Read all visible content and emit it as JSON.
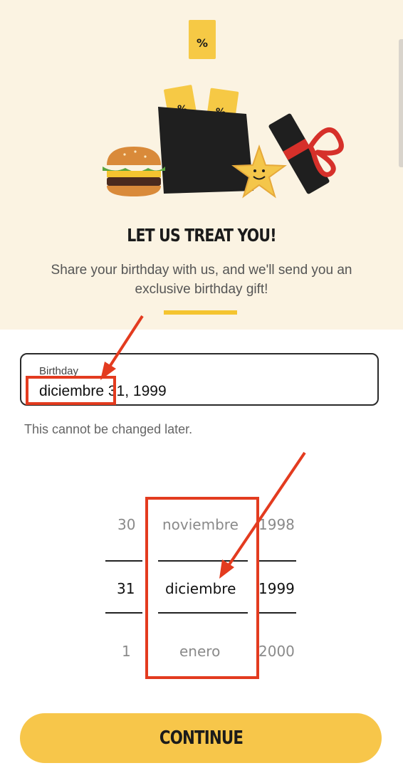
{
  "hero": {
    "title": "LET US TREAT YOU!",
    "description": "Share your birthday with us, and we'll send you an exclusive birthday gift!",
    "coupon_symbol": "%",
    "accent_color": "#f4c430",
    "background_color": "#fbf3e2"
  },
  "birthday_field": {
    "label": "Birthday",
    "value_month": "diciembre",
    "value_rest": " 31, 1999"
  },
  "helper_text": "This cannot be changed later.",
  "picker": {
    "day": {
      "prev": "30",
      "selected": "31",
      "next": "1"
    },
    "month": {
      "prev": "noviembre",
      "selected": "diciembre",
      "next": "enero"
    },
    "year": {
      "prev": "1998",
      "selected": "1999",
      "next": "2000"
    }
  },
  "continue_button": {
    "label": "CONTINUE",
    "color": "#f7c64a"
  },
  "annotation_color": "#e33b1f"
}
